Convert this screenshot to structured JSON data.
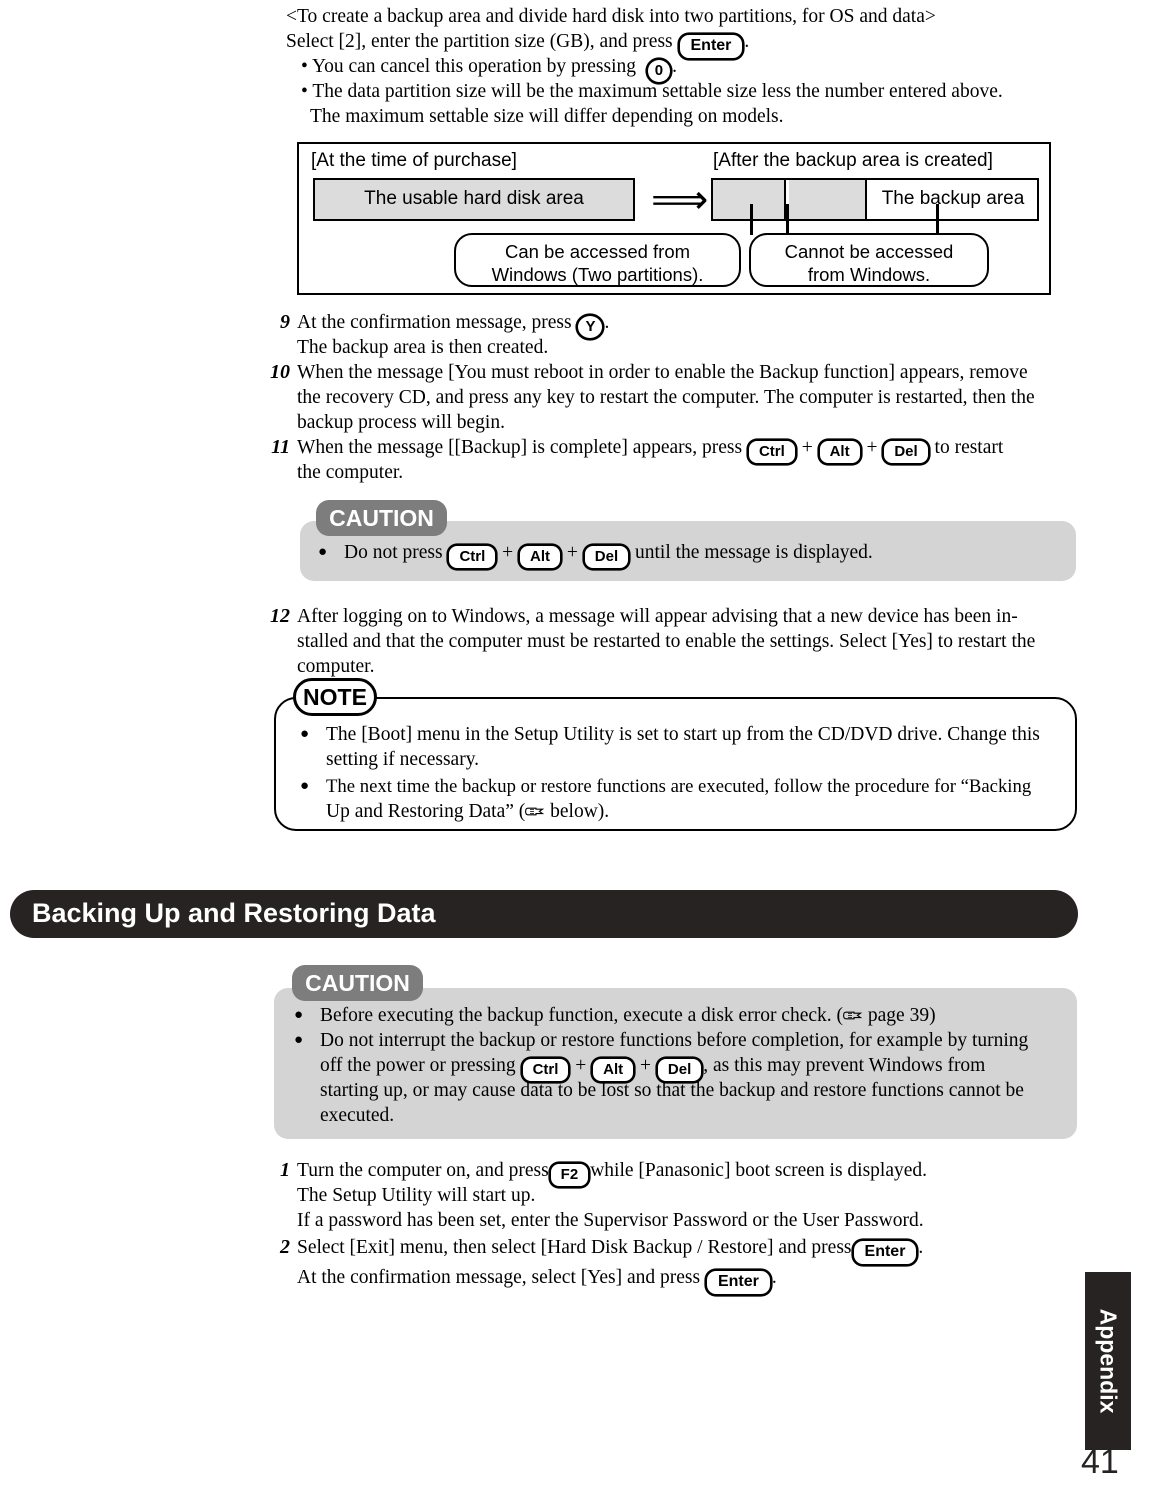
{
  "intro": {
    "lines": [
      "<To create a backup area and divide hard disk into two partitions, for OS and data>",
      "Select [2], enter the partition size (GB), and press",
      "• You can cancel this operation by pressing",
      "• The data partition size will be the maximum settable size less the number entered above.",
      "The maximum settable size will differ depending on models."
    ],
    "key_enter": "Enter",
    "key_zero": "0",
    "period_a": ".",
    "period_b": "."
  },
  "diagram": {
    "label_left": "[At the time of purchase]",
    "label_right": "[After the backup area is created]",
    "bar_left_text": "The usable hard disk area",
    "arrow": "⟹",
    "bar_right_backup_text": "The backup area",
    "callout_left": [
      "Can be accessed from",
      "Windows (Two partitions)."
    ],
    "callout_right": [
      "Cannot be accessed",
      "from Windows."
    ]
  },
  "steps_top": [
    {
      "num": "9",
      "lines": [
        {
          "pre": "At the confirmation message, press ",
          "key": "Y",
          "post": "."
        },
        {
          "pre": "The backup area is then created.",
          "key": "",
          "post": ""
        }
      ]
    },
    {
      "num": "10",
      "lines": [
        {
          "pre": "When the message [You must reboot in order to enable the Backup function] appears, remove",
          "key": "",
          "post": ""
        },
        {
          "pre": "the recovery CD, and press any key to restart the computer. The computer is restarted, then the",
          "key": "",
          "post": ""
        },
        {
          "pre": "backup process will begin.",
          "key": "",
          "post": ""
        }
      ]
    },
    {
      "num": "11",
      "lines": [
        {
          "pre": "When the message [[Backup] is complete] appears, press ",
          "keys": [
            "Ctrl",
            "Alt",
            "Del"
          ],
          "post": " to restart"
        },
        {
          "pre": "the computer.",
          "key": "",
          "post": ""
        }
      ]
    }
  ],
  "caution1": {
    "tab": "CAUTION",
    "bullet_dot": "●",
    "line_pre": "Do not press ",
    "keys": [
      "Ctrl",
      "Alt",
      "Del"
    ],
    "line_post": " until the message is displayed."
  },
  "step12": {
    "num": "12",
    "lines": [
      "After logging on to Windows, a message will appear advising that a new device has been in-",
      "stalled and that the computer must be restarted to enable the settings.  Select [Yes] to restart the",
      "computer."
    ]
  },
  "note1": {
    "tab": "NOTE",
    "bullet_dot": "●",
    "bullets": [
      [
        "The [Boot] menu in the Setup Utility is set to start up from the CD/DVD drive. Change this",
        "setting if necessary."
      ],
      [
        "The next time the backup or restore functions are executed, follow the procedure for “Backing",
        "Up and Restoring Data” ( below)."
      ]
    ],
    "ref_pre": "Up and Restoring Data” (",
    "ref_post": " below)."
  },
  "banner": {
    "title": "Backing Up and Restoring Data"
  },
  "caution2": {
    "tab": "CAUTION",
    "bullet_dot": "●",
    "b1_pre": "Before executing the backup function, execute a disk error check. (",
    "b1_post": " page 39)",
    "b2_l1": "Do not interrupt the backup or restore functions before completion, for example by turning",
    "b2_l2_pre": "off the power or pressing ",
    "b2_keys": [
      "Ctrl",
      "Alt",
      "Del"
    ],
    "b2_l2_post": ", as this may prevent Windows from",
    "b2_l3": "starting up, or may cause data to be lost so that the backup and restore functions cannot be",
    "b2_l4": "executed."
  },
  "steps_bottom": [
    {
      "num": "1",
      "l1_pre": "Turn the computer on, and press",
      "l1_key": "F2",
      "l1_post": "while [Panasonic] boot screen is displayed.",
      "l2": "The Setup Utility will start up.",
      "l3": "If a password has been set, enter the Supervisor Password or the User Password."
    },
    {
      "num": "2",
      "l1_pre": "Select [Exit] menu, then select [Hard Disk Backup / Restore] and press",
      "l1_key": "Enter",
      "l1_post": ".",
      "l2_pre": "At the confirmation message, select [Yes] and press ",
      "l2_key": "Enter",
      "l2_post": "."
    }
  ],
  "sidetab": {
    "label": "Appendix",
    "page_number": "41"
  },
  "colors": {
    "banner_bg": "#262322",
    "caution_tab_bg": "#7d7d7d",
    "caution_box_bg": "#d4d4d4",
    "segment_gray": "#dcdcdc"
  }
}
